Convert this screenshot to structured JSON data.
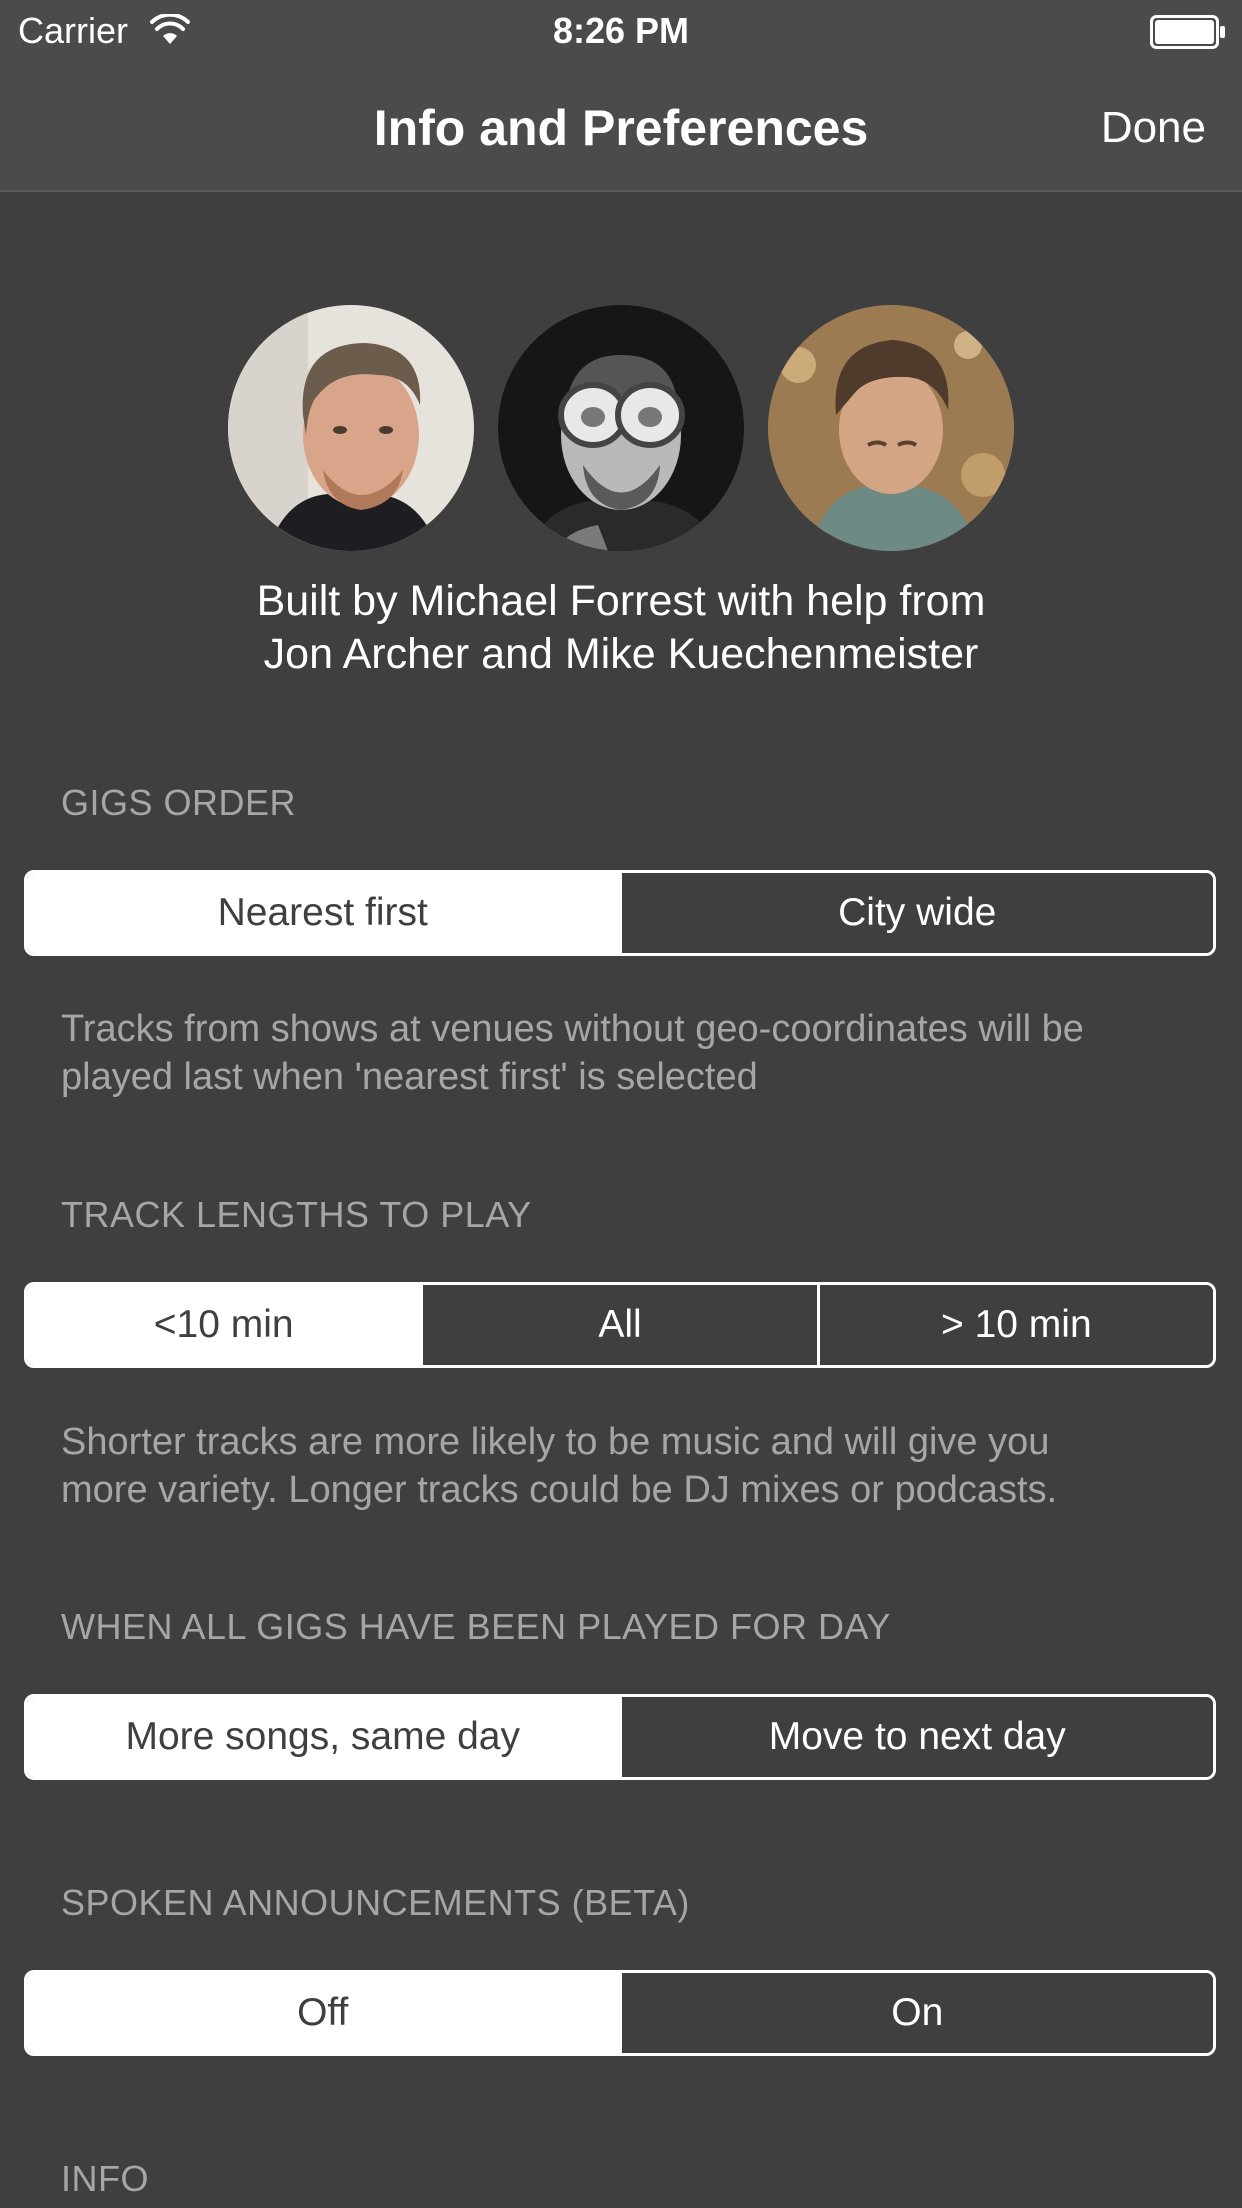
{
  "status_bar": {
    "carrier": "Carrier",
    "time": "8:26 PM",
    "wifi_icon": "wifi-icon",
    "battery_icon": "battery-icon"
  },
  "nav": {
    "title": "Info and Preferences",
    "done_label": "Done"
  },
  "credits": {
    "avatars": [
      "avatar-michael-forrest",
      "avatar-jon-archer",
      "avatar-mike-kuechenmeister"
    ],
    "line1": "Built by Michael Forrest with help from",
    "line2": "Jon Archer and Mike Kuechenmeister"
  },
  "gigs_order": {
    "header": "GIGS ORDER",
    "options": [
      "Nearest first",
      "City wide"
    ],
    "selected": "Nearest first",
    "footnote_line1": "Tracks from shows at venues without geo-coordinates will be",
    "footnote_line2": "played last when 'nearest first' is selected"
  },
  "track_lengths": {
    "header": "TRACK LENGTHS TO PLAY",
    "options": [
      "<10 min",
      "All",
      "> 10 min"
    ],
    "selected": "<10 min",
    "footnote_line1": "Shorter tracks are more likely to be music and will give you",
    "footnote_line2": "more variety. Longer tracks could be DJ mixes or podcasts."
  },
  "all_gigs_played": {
    "header": "WHEN ALL GIGS HAVE BEEN PLAYED FOR DAY",
    "options": [
      "More songs, same day",
      "Move to next day"
    ],
    "selected": "More songs, same day"
  },
  "spoken_announcements": {
    "header": "SPOKEN ANNOUNCEMENTS (BETA)",
    "options": [
      "Off",
      "On"
    ],
    "selected": "Off"
  },
  "info": {
    "header": "INFO"
  },
  "colors": {
    "background": "#3f3f3f",
    "bar": "#4b4b4b",
    "secondary_text": "#a6a6a6",
    "accent": "#ffffff"
  }
}
